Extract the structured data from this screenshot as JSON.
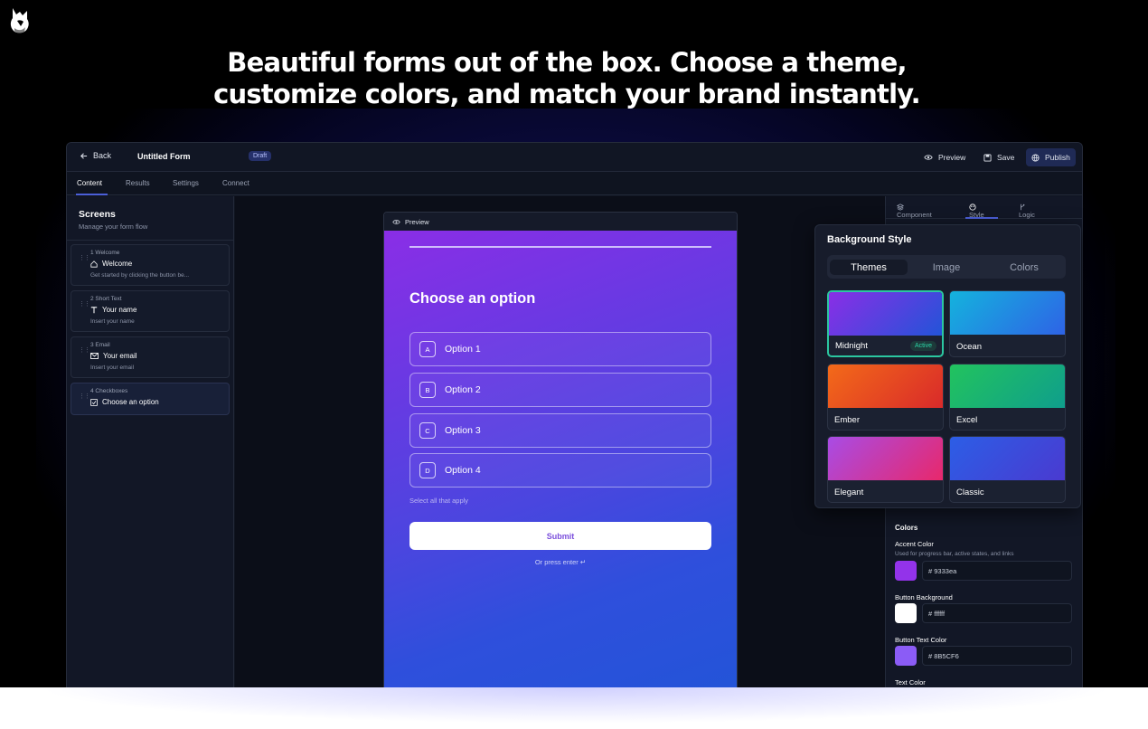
{
  "headline": {
    "line1": "Beautiful forms out of the box. Choose a theme,",
    "line2": "customize colors, and match your brand instantly."
  },
  "topbar": {
    "back_label": "Back",
    "form_title": "Untitled Form",
    "status_badge": "Draft",
    "preview_label": "Preview",
    "save_label": "Save",
    "publish_label": "Publish"
  },
  "tabs": [
    "Content",
    "Results",
    "Settings",
    "Connect"
  ],
  "sidebar": {
    "title": "Screens",
    "subtitle": "Manage your form flow",
    "screens": [
      {
        "meta": "1  Welcome",
        "name": "Welcome",
        "desc": "Get started by clicking the button be...",
        "icon": "home-icon"
      },
      {
        "meta": "2  Short Text",
        "name": "Your name",
        "desc": "Insert your name",
        "icon": "text-icon"
      },
      {
        "meta": "3  Email",
        "name": "Your email",
        "desc": "Insert your email",
        "icon": "mail-icon"
      },
      {
        "meta": "4  Checkboxes",
        "name": "Choose an option",
        "desc": "",
        "icon": "checkbox-icon"
      }
    ]
  },
  "preview": {
    "header_label": "Preview",
    "question": "Choose an option",
    "options": [
      {
        "key": "A",
        "label": "Option 1"
      },
      {
        "key": "B",
        "label": "Option 2"
      },
      {
        "key": "C",
        "label": "Option 3"
      },
      {
        "key": "D",
        "label": "Option 4"
      }
    ],
    "hint": "Select all that apply",
    "submit_label": "Submit",
    "enter_hint": "Or press enter ↵"
  },
  "right_tabs": [
    "Component",
    "Style",
    "Logic"
  ],
  "background_style": {
    "title": "Background Style",
    "segments": [
      "Themes",
      "Image",
      "Colors"
    ],
    "active_segment": "Themes",
    "themes": [
      {
        "name": "Midnight",
        "active": true,
        "badge": "Active",
        "from": "#8a2ee6",
        "to": "#2354d8"
      },
      {
        "name": "Ocean",
        "active": false,
        "from": "#14b3dd",
        "to": "#2e63e6"
      },
      {
        "name": "Ember",
        "active": false,
        "from": "#f36a19",
        "to": "#d92a2a"
      },
      {
        "name": "Excel",
        "active": false,
        "from": "#22c35e",
        "to": "#0f9e8c"
      },
      {
        "name": "Elegant",
        "active": false,
        "from": "#a84ce6",
        "to": "#e8286b"
      },
      {
        "name": "Classic",
        "active": false,
        "from": "#2c5ee6",
        "to": "#4a3ad0"
      }
    ]
  },
  "colors": {
    "section_title": "Colors",
    "items": [
      {
        "label": "Accent Color",
        "desc": "Used for progress bar, active states, and links",
        "hex": "# 9333ea",
        "swatch": "#9333ea"
      },
      {
        "label": "Button Background",
        "desc": "",
        "hex": "# ffffff",
        "swatch": "#ffffff"
      },
      {
        "label": "Button Text Color",
        "desc": "",
        "hex": "# 8B5CF6",
        "swatch": "#8B5CF6"
      },
      {
        "label": "Text Color",
        "desc": "",
        "hex": "",
        "swatch": ""
      }
    ]
  }
}
